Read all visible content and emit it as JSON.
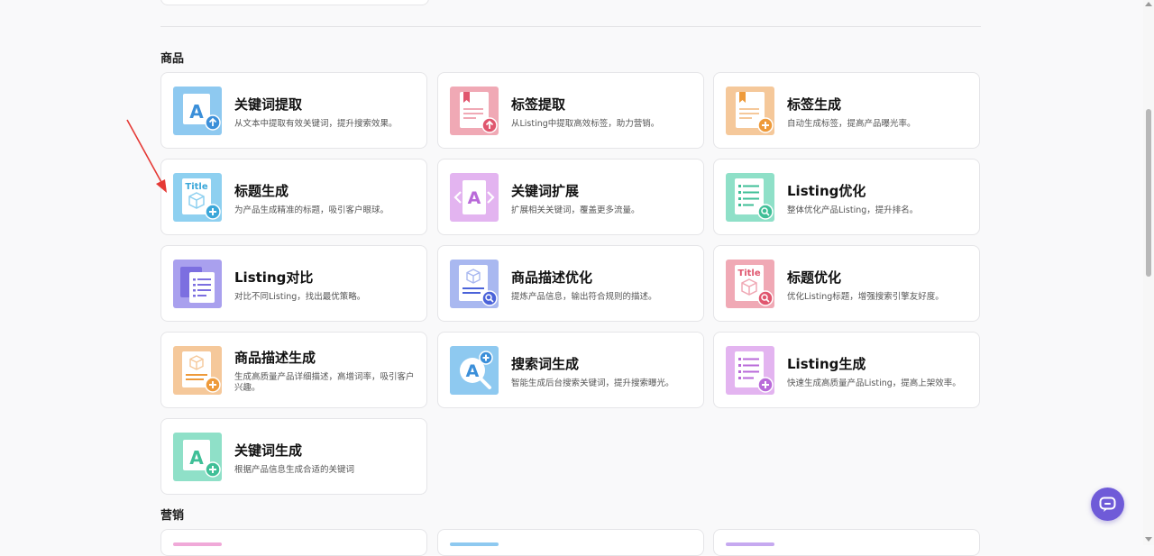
{
  "sections": {
    "products": {
      "title": "商品"
    },
    "marketing": {
      "title": "营销"
    }
  },
  "cards": [
    {
      "title": "关键词提取",
      "desc": "从文本中提取有效关键词，提升搜索效果。",
      "icon": "keyword-extract-icon",
      "color": "#8ec9f0"
    },
    {
      "title": "标签提取",
      "desc": "从Listing中提取高效标签，助力营销。",
      "icon": "tag-extract-icon",
      "color": "#f0a9b5"
    },
    {
      "title": "标签生成",
      "desc": "自动生成标签，提高产品曝光率。",
      "icon": "tag-generate-icon",
      "color": "#f5c89a"
    },
    {
      "title": "标题生成",
      "desc": "为产品生成精准的标题，吸引客户眼球。",
      "icon": "title-generate-icon",
      "color": "#8ed0f0"
    },
    {
      "title": "关键词扩展",
      "desc": "扩展相关关键词，覆盖更多流量。",
      "icon": "keyword-expand-icon",
      "color": "#e3b4f0"
    },
    {
      "title": "Listing优化",
      "desc": "整体优化产品Listing，提升排名。",
      "icon": "listing-optimize-icon",
      "color": "#8fe0c8"
    },
    {
      "title": "Listing对比",
      "desc": "对比不同Listing，找出最优策略。",
      "icon": "listing-compare-icon",
      "color": "#a9a0ee"
    },
    {
      "title": "商品描述优化",
      "desc": "提炼产品信息，输出符合规则的描述。",
      "icon": "description-optimize-icon",
      "color": "#a9b8f0"
    },
    {
      "title": "标题优化",
      "desc": "优化Listing标题，增强搜索引擎友好度。",
      "icon": "title-optimize-icon",
      "color": "#f0a9b5"
    },
    {
      "title": "商品描述生成",
      "desc": "生成高质量产品详细描述，高增词率，吸引客户兴趣。",
      "icon": "description-generate-icon",
      "color": "#f5c89a"
    },
    {
      "title": "搜索词生成",
      "desc": "智能生成后台搜索关键词，提升搜索曝光。",
      "icon": "search-term-icon",
      "color": "#8ec9f0"
    },
    {
      "title": "Listing生成",
      "desc": "快速生成高质量产品Listing，提高上架效率。",
      "icon": "listing-generate-icon",
      "color": "#e3b4f0"
    },
    {
      "title": "关键词生成",
      "desc": "根据产品信息生成合适的关键词",
      "icon": "keyword-generate-icon",
      "color": "#8fe0c8"
    }
  ],
  "marketing_peek_colors": [
    "#f0a9d8",
    "#8ec9f0",
    "#c6a9f0"
  ],
  "accent": "#6f5bd8",
  "annotation_arrow_color": "#e53935"
}
